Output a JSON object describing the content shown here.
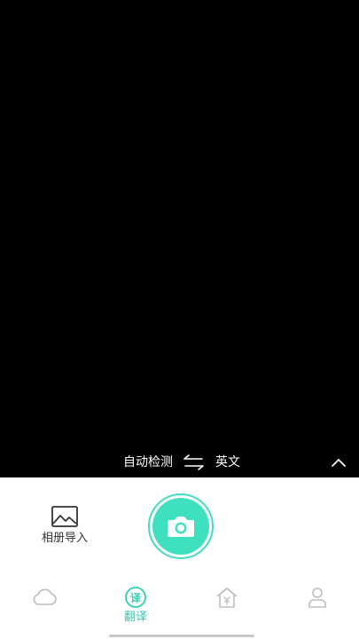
{
  "language_bar": {
    "source_language": "自动检测",
    "target_language": "英文",
    "swap_icon": "swap-arrows-icon",
    "collapse_icon": "chevron-up-icon"
  },
  "capture_panel": {
    "album_import_label": "相册导入",
    "album_icon": "image-icon",
    "shutter_icon": "camera-icon"
  },
  "bottom_nav": {
    "items": [
      {
        "icon": "cloud-icon",
        "label": "",
        "active": false
      },
      {
        "icon": "translate-icon",
        "label": "翻译",
        "active": true
      },
      {
        "icon": "home-yen-icon",
        "label": "",
        "active": false
      },
      {
        "icon": "person-icon",
        "label": "",
        "active": false
      }
    ]
  },
  "colors": {
    "accent": "#3fe0c0",
    "accent_text": "#2ccfb0",
    "viewfinder": "#000000",
    "inactive_icon": "#bdbdbd"
  }
}
